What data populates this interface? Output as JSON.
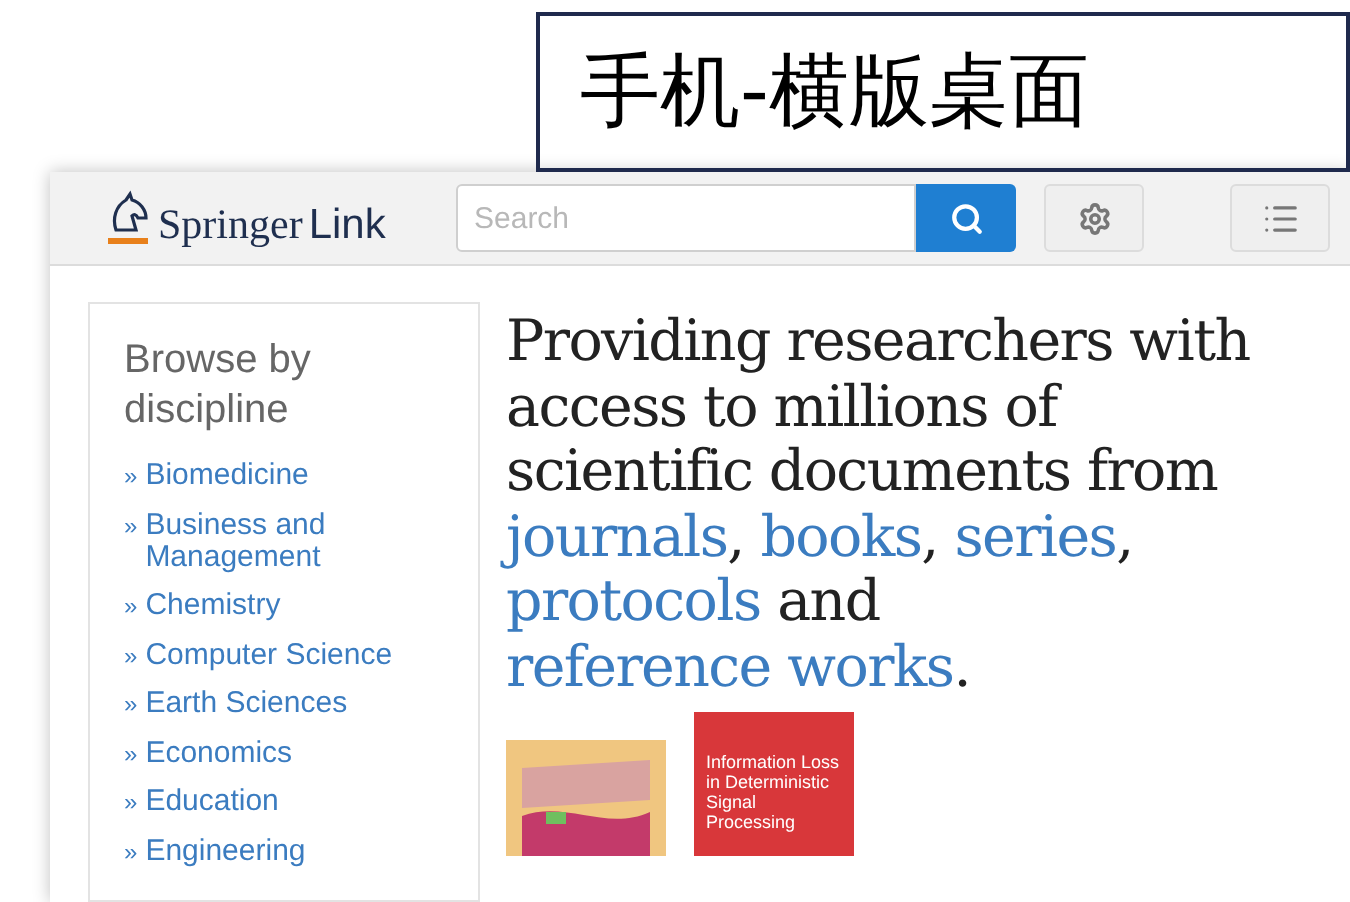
{
  "slide_title": "手机-横版桌面",
  "header": {
    "logo_text": "Springer",
    "logo_suffix": "Link",
    "search": {
      "placeholder": "Search"
    }
  },
  "sidebar": {
    "heading": "Browse by discipline",
    "items": [
      {
        "marker": "»",
        "label": "Biomedicine"
      },
      {
        "marker": "»",
        "label": "Business and Management"
      },
      {
        "marker": "»",
        "label": "Chemistry"
      },
      {
        "marker": "»",
        "label": "Computer Science"
      },
      {
        "marker": "»",
        "label": "Earth Sciences"
      },
      {
        "marker": "»",
        "label": "Economics"
      },
      {
        "marker": "»",
        "label": "Education"
      },
      {
        "marker": "»",
        "label": "Engineering"
      }
    ]
  },
  "headline": [
    {
      "kind": "plain",
      "text": "Providing researchers with access to millions of scientific documents from "
    },
    {
      "kind": "link",
      "text": "journals"
    },
    {
      "kind": "plain",
      "text": ", "
    },
    {
      "kind": "link",
      "text": "books"
    },
    {
      "kind": "plain",
      "text": ", "
    },
    {
      "kind": "link",
      "text": "series"
    },
    {
      "kind": "plain",
      "text": ", "
    },
    {
      "kind": "link",
      "text": "protocols"
    },
    {
      "kind": "plain",
      "text": " and "
    },
    {
      "kind": "link",
      "text": "reference works"
    },
    {
      "kind": "plain",
      "text": "."
    }
  ],
  "books": [
    {
      "kind": "map"
    },
    {
      "kind": "titled",
      "title": "Information Loss in Deterministic Signal Processing"
    }
  ]
}
